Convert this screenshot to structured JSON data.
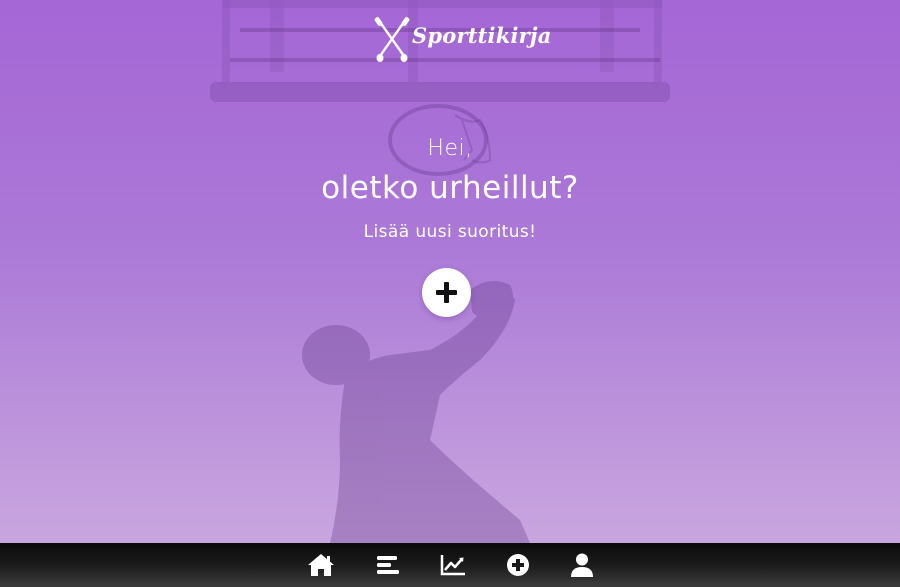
{
  "app": {
    "brand": "Sporttikirja",
    "logo_icon": "crossed-oars-icon"
  },
  "hero": {
    "greeting": "Hei,",
    "question": "oletko urheillut?",
    "subline": "Lisää uusi suoritus!",
    "add_icon": "plus-icon",
    "colors": {
      "gradient_top": "#a566d6",
      "gradient_bottom": "#c9a6df"
    }
  },
  "nav": {
    "items": [
      {
        "icon": "home-icon"
      },
      {
        "icon": "list-icon"
      },
      {
        "icon": "chart-icon"
      },
      {
        "icon": "add-circle-icon"
      },
      {
        "icon": "user-icon"
      }
    ]
  }
}
